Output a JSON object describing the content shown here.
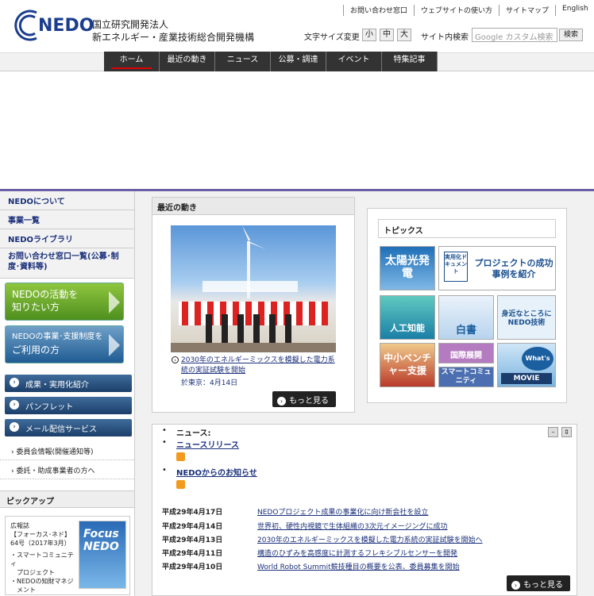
{
  "header": {
    "logo_text": "NEDO",
    "org_line1": "国立研究開発法人",
    "org_line2": "新エネルギー・産業技術総合開発機構",
    "top_links": [
      "お問い合わせ窓口",
      "ウェブサイトの使い方",
      "サイトマップ",
      "English"
    ],
    "font_size_label": "文字サイズ変更",
    "font_sizes": [
      "小",
      "中",
      "大"
    ],
    "search_label": "サイト内検索",
    "search_placeholder": "Google カスタム検索",
    "search_button": "検索"
  },
  "nav": {
    "items": [
      "ホーム",
      "最近の動き",
      "ニュース",
      "公募・調達",
      "イベント",
      "特集記事"
    ],
    "active": "ホーム"
  },
  "sidebar": {
    "links": [
      "NEDOについて",
      "事業一覧",
      "NEDOライブラリ",
      "お問い合わせ窓口一覧(公募･制度･資料等)"
    ],
    "banner1": {
      "line1": "NEDOの活動を",
      "line2": "知りたい方"
    },
    "banner2": {
      "line1": "NEDOの事業･支援制度を",
      "line2": "ご利用の方"
    },
    "buttons": [
      "成果・実用化紹介",
      "パンフレット",
      "メール配信サービス"
    ],
    "sublinks": [
      "委員会情報(開催通知等)",
      "委託・助成事業者の方へ"
    ],
    "pickup_title": "ピックアップ",
    "pickup_text": [
      "広報誌",
      "【フォーカス･ネド】",
      "64号（2017年3月）",
      "・スマートコミュニティ",
      "　プロジェクト",
      "・NEDOの知財マネジ",
      "　メント"
    ],
    "pickup_cover": "Focus NEDO"
  },
  "recent": {
    "title": "最近の動き",
    "link_text": "2030年のエネルギーミックスを模擬した電力系統の実証試験を開始",
    "date_text": "於東京：4月14日",
    "more": "もっと見る"
  },
  "topics": {
    "title": "トピックス",
    "tiles": [
      "太陽光発電",
      "プロジェクトの成功事例を紹介",
      "人工知能",
      "白書",
      "身近なところにNEDO技術",
      "中小ベンチャー支援",
      "国際展開",
      "スマートコミュニティ",
      "What's NEDO?",
      "MOVIE"
    ],
    "doc_label": "実用化ドキュメント"
  },
  "news": {
    "head1": "ニュース:",
    "head2": "ニュースリリース",
    "head3": "NEDOからのお知らせ",
    "rows": [
      {
        "date": "平成29年4月17日",
        "title": "NEDOプロジェクト成果の事業化に向け新会社を設立"
      },
      {
        "date": "平成29年4月14日",
        "title": "世界初、硬性内視鏡で生体組織の3次元イメージングに成功"
      },
      {
        "date": "平成29年4月13日",
        "title": "2030年のエネルギーミックスを模擬した電力系統の実証試験を開始へ"
      },
      {
        "date": "平成29年4月11日",
        "title": "構造のひずみを高感度に計測するフレキシブルセンサーを開発"
      },
      {
        "date": "平成29年4月10日",
        "title": "World Robot Summit競技種目の概要を公表、委員募集を開始"
      }
    ],
    "more": "もっと見る"
  }
}
